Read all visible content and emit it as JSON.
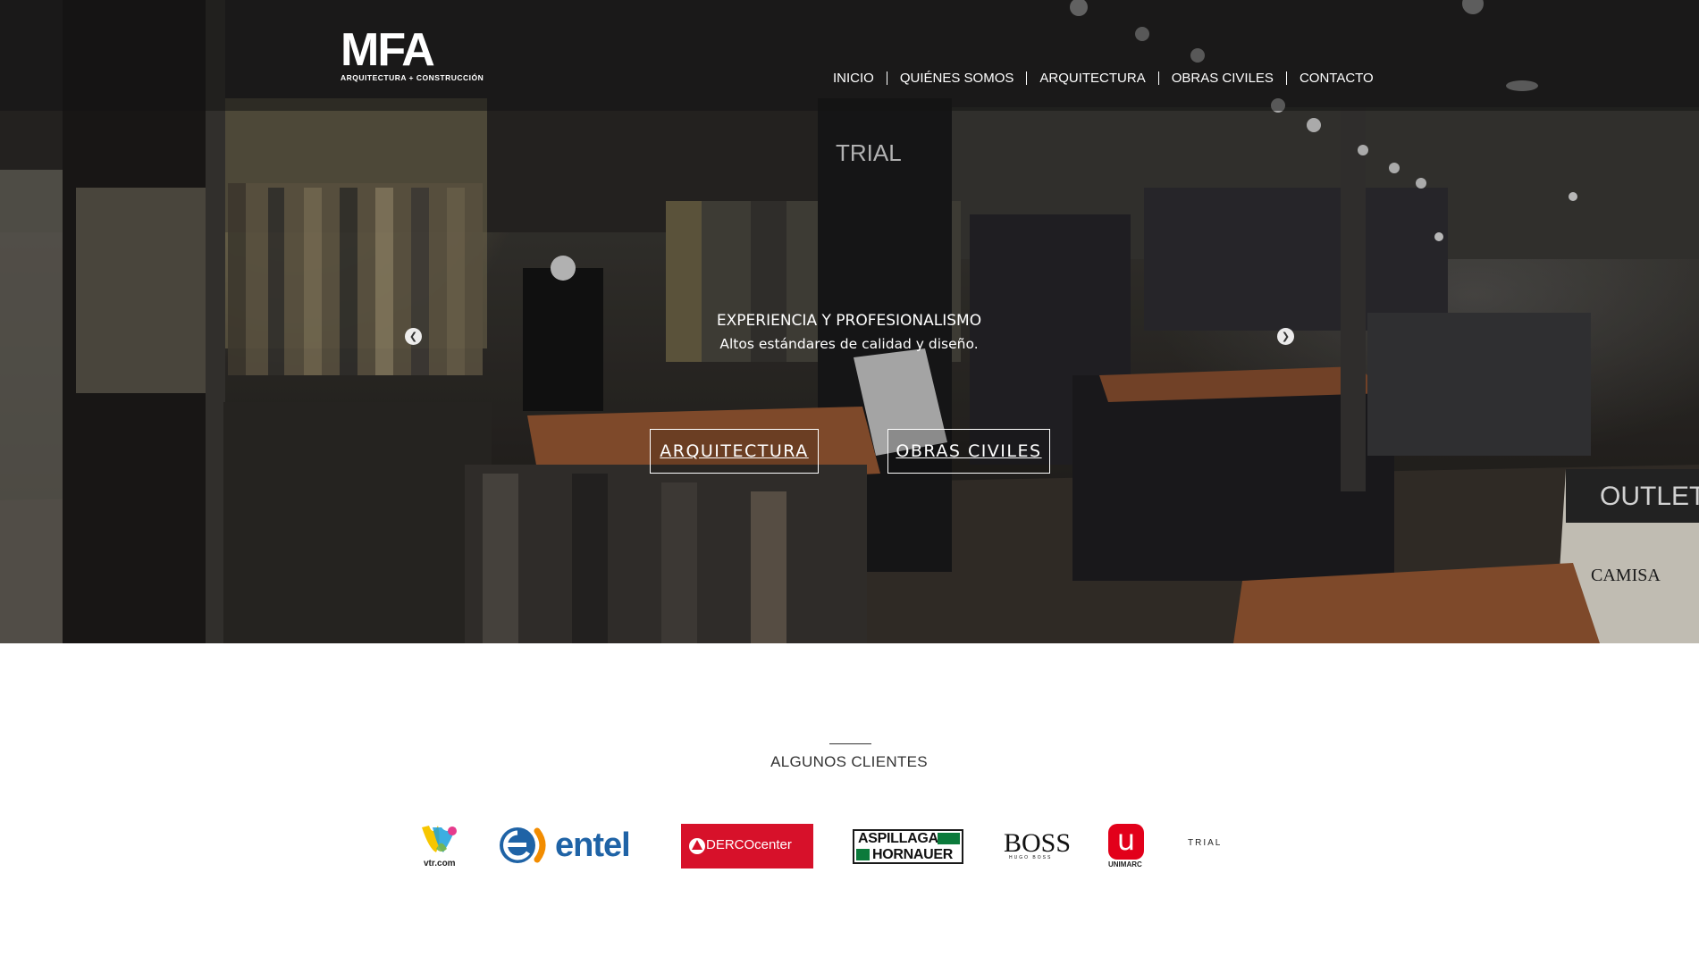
{
  "brand": {
    "logo_mark": "MFA",
    "logo_sub": "ARQUITECTURA + CONSTRUCCIÓN"
  },
  "nav": {
    "items": [
      {
        "label": "INICIO"
      },
      {
        "label": "QUIÉNES SOMOS"
      },
      {
        "label": "ARQUITECTURA"
      },
      {
        "label": "OBRAS CIVILES"
      },
      {
        "label": "CONTACTO"
      }
    ]
  },
  "slider": {
    "title": "EXPERIENCIA Y PROFESIONALISMO",
    "subtitle": "Altos estándares de calidad y diseño.",
    "prev_icon": "chevron-left-icon",
    "next_icon": "chevron-right-icon",
    "buttons": {
      "arquitectura": "ARQUITECTURA",
      "obras_civiles": "OBRAS CIVILES"
    }
  },
  "clients": {
    "title": "ALGUNOS CLIENTES",
    "logos": {
      "vtr": "vtr.com",
      "entel": "entel",
      "derco": "DERCOcenter",
      "aspillaga_line1": "ASPILLAGA",
      "aspillaga_line2": "HORNAUER",
      "boss": "BOSS",
      "boss_sub": "HUGO BOSS",
      "unimarc": "UNIMARC",
      "trial": "TRIAL"
    }
  },
  "colors": {
    "topbar": "#141414",
    "entel_blue": "#1f63a6",
    "entel_orange": "#f28c00",
    "derco_red": "#d7112a",
    "aspillaga_green": "#0b7a3b",
    "unimarc_red": "#e2001a"
  }
}
